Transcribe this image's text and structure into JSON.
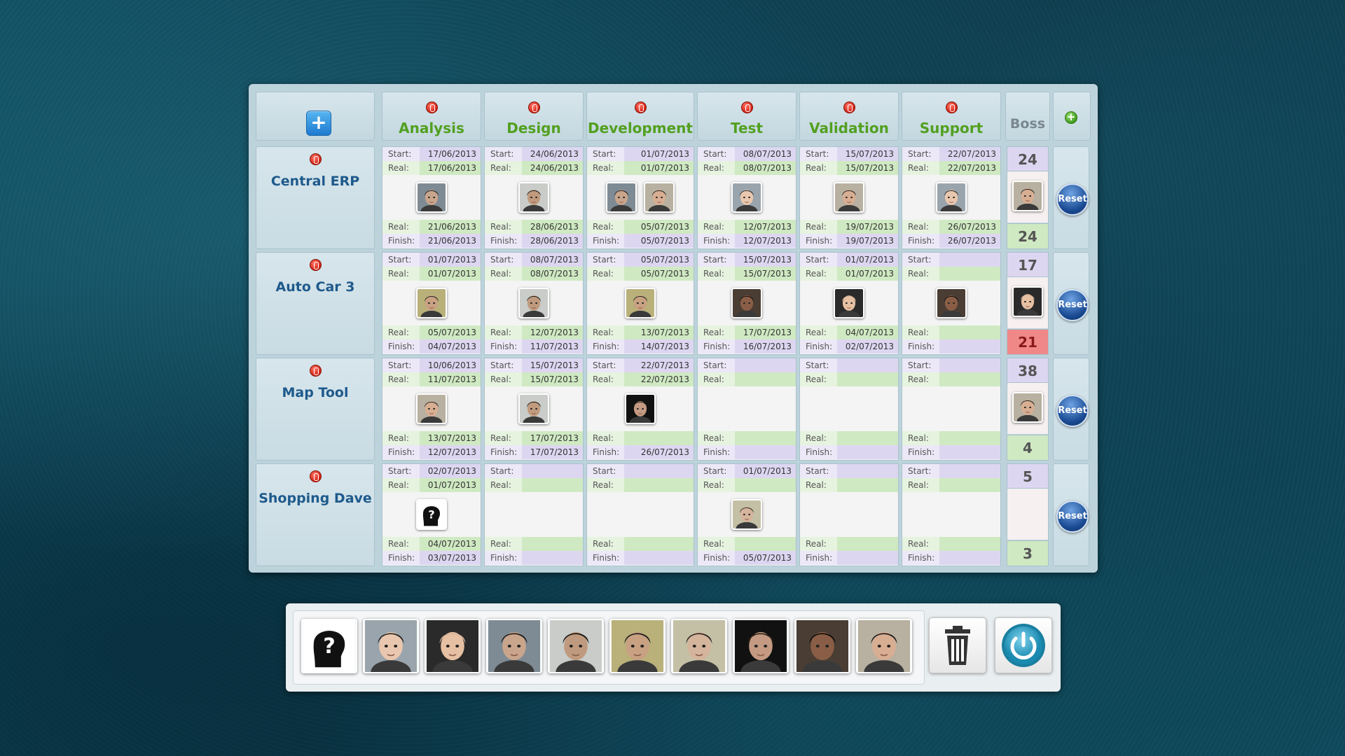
{
  "header": {
    "add_project_label": "+",
    "stages": [
      "Analysis",
      "Design",
      "Development",
      "Test",
      "Validation",
      "Support"
    ],
    "boss_label": "Boss",
    "add_stage_label": "+"
  },
  "labels": {
    "start": "Start:",
    "real": "Real:",
    "finish": "Finish:",
    "reset": "Reset"
  },
  "projects": [
    {
      "name": "Central ERP",
      "boss_top": "24",
      "boss_bottom": "24",
      "boss_bottom_alert": false,
      "boss_face": "f9",
      "cells": [
        {
          "start": "17/06/2013",
          "start_real": "17/06/2013",
          "faces": [
            "f3"
          ],
          "finish_real": "21/06/2013",
          "finish": "21/06/2013"
        },
        {
          "start": "24/06/2013",
          "start_real": "24/06/2013",
          "faces": [
            "f4"
          ],
          "finish_real": "28/06/2013",
          "finish": "28/06/2013"
        },
        {
          "start": "01/07/2013",
          "start_real": "01/07/2013",
          "faces": [
            "f3",
            "f9"
          ],
          "finish_real": "05/07/2013",
          "finish": "05/07/2013"
        },
        {
          "start": "08/07/2013",
          "start_real": "08/07/2013",
          "faces": [
            "f1"
          ],
          "finish_real": "12/07/2013",
          "finish": "12/07/2013"
        },
        {
          "start": "15/07/2013",
          "start_real": "15/07/2013",
          "faces": [
            "f9"
          ],
          "finish_real": "19/07/2013",
          "finish": "19/07/2013"
        },
        {
          "start": "22/07/2013",
          "start_real": "22/07/2013",
          "faces": [
            "f1"
          ],
          "finish_real": "26/07/2013",
          "finish": "26/07/2013"
        }
      ]
    },
    {
      "name": "Auto Car 3",
      "boss_top": "17",
      "boss_bottom": "21",
      "boss_bottom_alert": true,
      "boss_face": "f2",
      "cells": [
        {
          "start": "01/07/2013",
          "start_real": "01/07/2013",
          "faces": [
            "f5"
          ],
          "finish_real": "05/07/2013",
          "finish": "04/07/2013"
        },
        {
          "start": "08/07/2013",
          "start_real": "08/07/2013",
          "faces": [
            "f4"
          ],
          "finish_real": "12/07/2013",
          "finish": "11/07/2013"
        },
        {
          "start": "05/07/2013",
          "start_real": "05/07/2013",
          "faces": [
            "f5"
          ],
          "finish_real": "13/07/2013",
          "finish": "14/07/2013"
        },
        {
          "start": "15/07/2013",
          "start_real": "15/07/2013",
          "faces": [
            "f8"
          ],
          "finish_real": "17/07/2013",
          "finish": "16/07/2013"
        },
        {
          "start": "01/07/2013",
          "start_real": "01/07/2013",
          "faces": [
            "f2"
          ],
          "finish_real": "04/07/2013",
          "finish": "02/07/2013"
        },
        {
          "start": "",
          "start_real": "",
          "faces": [
            "f8"
          ],
          "finish_real": "",
          "finish": ""
        }
      ]
    },
    {
      "name": "Map Tool",
      "boss_top": "38",
      "boss_bottom": "4",
      "boss_bottom_alert": false,
      "boss_face": "f9",
      "cells": [
        {
          "start": "10/06/2013",
          "start_real": "11/07/2013",
          "faces": [
            "f9"
          ],
          "finish_real": "13/07/2013",
          "finish": "12/07/2013"
        },
        {
          "start": "15/07/2013",
          "start_real": "15/07/2013",
          "faces": [
            "f4"
          ],
          "finish_real": "17/07/2013",
          "finish": "17/07/2013"
        },
        {
          "start": "22/07/2013",
          "start_real": "22/07/2013",
          "faces": [
            "f7"
          ],
          "finish_real": "",
          "finish": "26/07/2013"
        },
        {
          "start": "",
          "start_real": "",
          "faces": [],
          "finish_real": "",
          "finish": ""
        },
        {
          "start": "",
          "start_real": "",
          "faces": [],
          "finish_real": "",
          "finish": ""
        },
        {
          "start": "",
          "start_real": "",
          "faces": [],
          "finish_real": "",
          "finish": ""
        }
      ]
    },
    {
      "name": "Shopping Dave",
      "boss_top": "5",
      "boss_bottom": "3",
      "boss_bottom_alert": false,
      "boss_face": "",
      "cells": [
        {
          "start": "02/07/2013",
          "start_real": "01/07/2013",
          "faces": [
            "unknown"
          ],
          "finish_real": "04/07/2013",
          "finish": "03/07/2013"
        },
        {
          "start": "",
          "start_real": "",
          "faces": [],
          "finish_real": "",
          "finish": ""
        },
        {
          "start": "",
          "start_real": "",
          "faces": [],
          "finish_real": "",
          "finish": ""
        },
        {
          "start": "01/07/2013",
          "start_real": "",
          "faces": [
            "f6"
          ],
          "finish_real": "",
          "finish": "05/07/2013"
        },
        {
          "start": "",
          "start_real": "",
          "faces": [],
          "finish_real": "",
          "finish": ""
        },
        {
          "start": "",
          "start_real": "",
          "faces": [],
          "finish_real": "",
          "finish": ""
        }
      ]
    }
  ],
  "palette": {
    "people": [
      "unknown",
      "f1",
      "f2",
      "f3",
      "f4",
      "f5",
      "f6",
      "f7",
      "f8",
      "f9"
    ],
    "tools": [
      "trash-icon",
      "power-icon"
    ]
  },
  "face_styles": {
    "f1": {
      "bg": "#9aa4ac",
      "skin": "#e9c7ae",
      "hair": "#222222"
    },
    "f2": {
      "bg": "#2a2a2a",
      "skin": "#e6c0a2",
      "hair": "#d9b59a"
    },
    "f3": {
      "bg": "#7f8b94",
      "skin": "#c9a58c",
      "hair": "#1c1c1c"
    },
    "f4": {
      "bg": "#c9ccc8",
      "skin": "#c09a7e",
      "hair": "#111111"
    },
    "f5": {
      "bg": "#b9b07a",
      "skin": "#c8a182",
      "hair": "#1a1a1a"
    },
    "f6": {
      "bg": "#c4c0a6",
      "skin": "#d5b49c",
      "hair": "#2a2520"
    },
    "f7": {
      "bg": "#111111",
      "skin": "#c49a82",
      "hair": "#2b2018"
    },
    "f8": {
      "bg": "#4a3d33",
      "skin": "#8a5e46",
      "hair": "#0e0b09"
    },
    "f9": {
      "bg": "#b8b0a0",
      "skin": "#d8ae92",
      "hair": "#1a1a1a"
    }
  }
}
